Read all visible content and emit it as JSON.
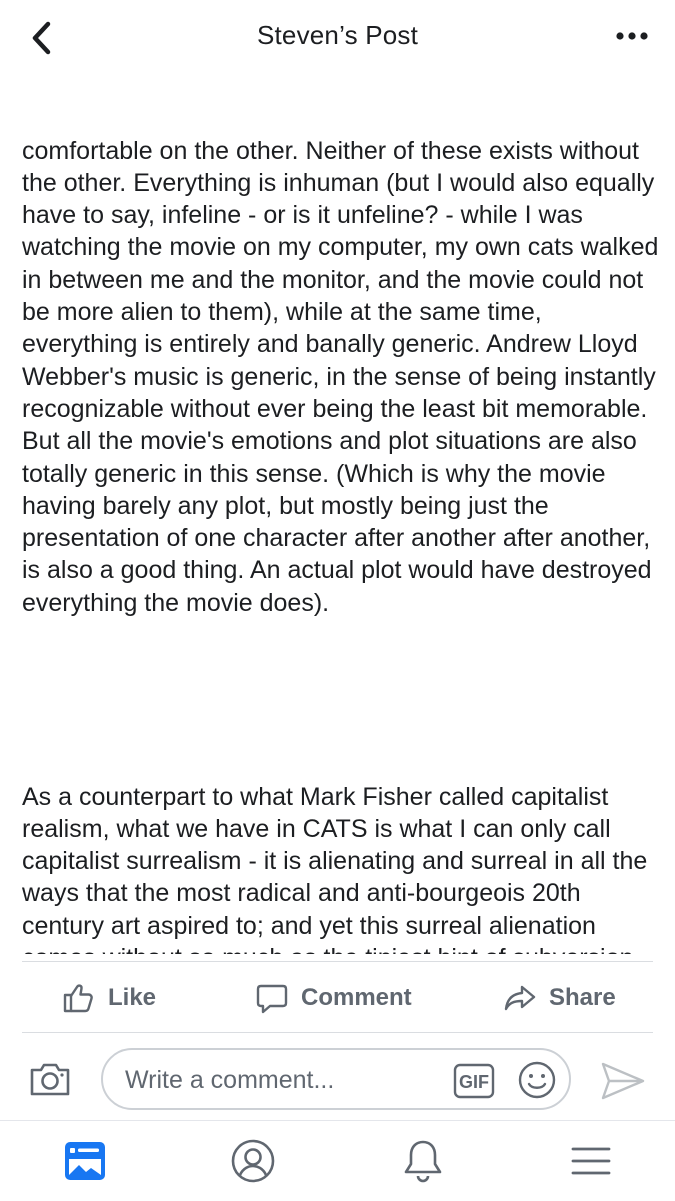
{
  "header": {
    "title": "Steven’s Post"
  },
  "post": {
    "paragraphs": [
      "comfortable on the other. Neither of these exists without the other. Everything is inhuman (but I would also equally have to say, infeline - or is it unfeline? - while I was watching the movie on my computer, my own cats walked in between me and the monitor, and the movie could not be more alien to them), while at the same time, everything is entirely and banally generic. Andrew Lloyd Webber's music is generic, in the sense of being instantly recognizable without ever being the least bit memorable. But all the movie's emotions and plot situations are also totally generic in this sense. (Which is why the movie having barely any plot, but mostly being just the presentation of one character after another after another, is also a good thing. An actual plot would have destroyed everything the movie does).",
      "As a counterpart to what Mark Fisher called capitalist realism, what we have in CATS is what I can only call capitalist surrealism - it is alienating and surreal in all the ways that the most radical and anti-bourgeois 20th century art aspired to; and yet this surreal alienation comes without so much as the tiniest hint of subversion, opposition, liberation, etc. CATS may not be what we need, but it is in a very concrete sense what we deserve; and I found it spellbinding on that account)."
    ]
  },
  "actions": {
    "like": "Like",
    "comment": "Comment",
    "share": "Share"
  },
  "composer": {
    "placeholder": "Write a comment..."
  },
  "colors": {
    "text": "#1c1e21",
    "secondary": "#606770",
    "divider": "#dadde1",
    "active_tab": "#1877f2"
  },
  "icons": {
    "back": "chevron-left-icon",
    "more": "more-dots-icon",
    "like": "thumbs-up-icon",
    "comment": "speech-bubble-icon",
    "share": "share-arrow-icon",
    "camera": "camera-icon",
    "gif": "gif-icon",
    "emoji": "emoji-icon",
    "send": "send-icon",
    "feed": "news-feed-icon",
    "profile": "profile-icon",
    "notifications": "bell-icon",
    "menu": "hamburger-menu-icon"
  }
}
